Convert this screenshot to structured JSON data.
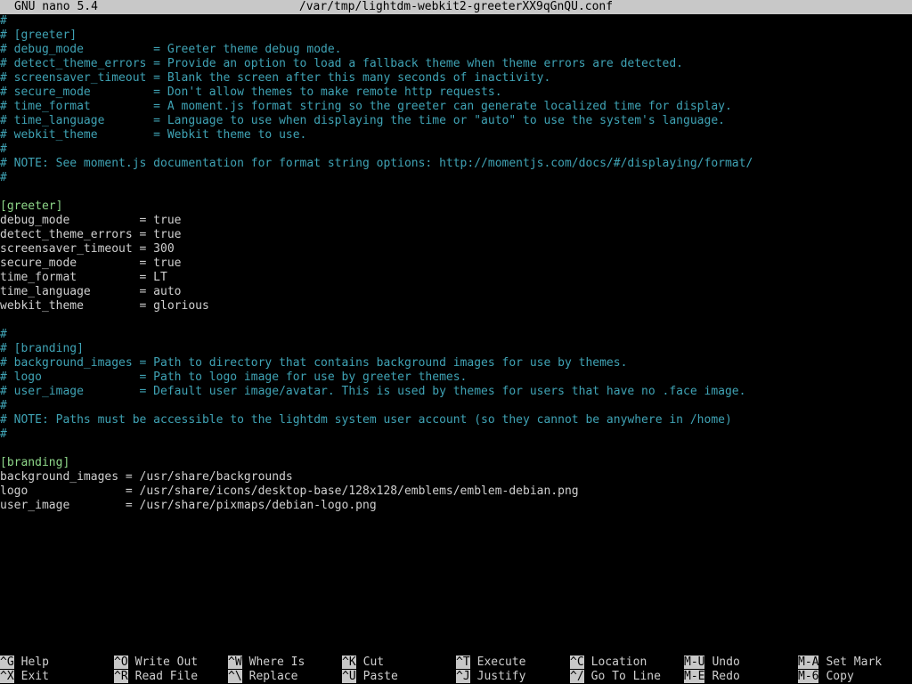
{
  "titlebar": {
    "app": "GNU nano 5.4",
    "filename": "/var/tmp/lightdm-webkit2-greeterXX9qGnQU.conf"
  },
  "editor": {
    "lines": [
      {
        "text": "#",
        "type": "comment"
      },
      {
        "text": "# [greeter]",
        "type": "comment"
      },
      {
        "text": "# debug_mode          = Greeter theme debug mode.",
        "type": "comment"
      },
      {
        "text": "# detect_theme_errors = Provide an option to load a fallback theme when theme errors are detected.",
        "type": "comment"
      },
      {
        "text": "# screensaver_timeout = Blank the screen after this many seconds of inactivity.",
        "type": "comment"
      },
      {
        "text": "# secure_mode         = Don't allow themes to make remote http requests.",
        "type": "comment"
      },
      {
        "text": "# time_format         = A moment.js format string so the greeter can generate localized time for display.",
        "type": "comment"
      },
      {
        "text": "# time_language       = Language to use when displaying the time or \"auto\" to use the system's language.",
        "type": "comment"
      },
      {
        "text": "# webkit_theme        = Webkit theme to use.",
        "type": "comment"
      },
      {
        "text": "#",
        "type": "comment"
      },
      {
        "text": "# NOTE: See moment.js documentation for format string options: http://momentjs.com/docs/#/displaying/format/",
        "type": "comment"
      },
      {
        "text": "#",
        "type": "comment"
      },
      {
        "text": "",
        "type": "normal"
      },
      {
        "text": "[greeter]",
        "type": "section"
      },
      {
        "text": "debug_mode          = true",
        "type": "normal"
      },
      {
        "text": "detect_theme_errors = true",
        "type": "normal"
      },
      {
        "text": "screensaver_timeout = 300",
        "type": "normal"
      },
      {
        "text": "secure_mode         = true",
        "type": "normal"
      },
      {
        "text": "time_format         = LT",
        "type": "normal"
      },
      {
        "text": "time_language       = auto",
        "type": "normal"
      },
      {
        "text": "webkit_theme        = glorious",
        "type": "normal"
      },
      {
        "text": "",
        "type": "normal"
      },
      {
        "text": "#",
        "type": "comment"
      },
      {
        "text": "# [branding]",
        "type": "comment"
      },
      {
        "text": "# background_images = Path to directory that contains background images for use by themes.",
        "type": "comment"
      },
      {
        "text": "# logo              = Path to logo image for use by greeter themes.",
        "type": "comment"
      },
      {
        "text": "# user_image        = Default user image/avatar. This is used by themes for users that have no .face image.",
        "type": "comment"
      },
      {
        "text": "#",
        "type": "comment"
      },
      {
        "text": "# NOTE: Paths must be accessible to the lightdm system user account (so they cannot be anywhere in /home)",
        "type": "comment"
      },
      {
        "text": "#",
        "type": "comment"
      },
      {
        "text": "",
        "type": "normal"
      },
      {
        "text": "[branding]",
        "type": "section"
      },
      {
        "text": "background_images = /usr/share/backgrounds",
        "type": "normal"
      },
      {
        "text": "logo              = /usr/share/icons/desktop-base/128x128/emblems/emblem-debian.png",
        "type": "normal"
      },
      {
        "text": "user_image        = /usr/share/pixmaps/debian-logo.png",
        "type": "normal"
      }
    ]
  },
  "shortcuts": {
    "row1": [
      {
        "key": "^G",
        "label": "Help"
      },
      {
        "key": "^O",
        "label": "Write Out"
      },
      {
        "key": "^W",
        "label": "Where Is"
      },
      {
        "key": "^K",
        "label": "Cut"
      },
      {
        "key": "^T",
        "label": "Execute"
      },
      {
        "key": "^C",
        "label": "Location"
      },
      {
        "key": "M-U",
        "label": "Undo"
      },
      {
        "key": "M-A",
        "label": "Set Mark"
      }
    ],
    "row2": [
      {
        "key": "^X",
        "label": "Exit"
      },
      {
        "key": "^R",
        "label": "Read File"
      },
      {
        "key": "^\\",
        "label": "Replace"
      },
      {
        "key": "^U",
        "label": "Paste"
      },
      {
        "key": "^J",
        "label": "Justify"
      },
      {
        "key": "^/",
        "label": "Go To Line"
      },
      {
        "key": "M-E",
        "label": "Redo"
      },
      {
        "key": "M-6",
        "label": "Copy"
      }
    ]
  },
  "colors": {
    "comment": "#3fa3b5",
    "section": "#8fd88a",
    "text": "#d0d0d0",
    "bar": "#c8c8c8",
    "background": "#000000"
  }
}
